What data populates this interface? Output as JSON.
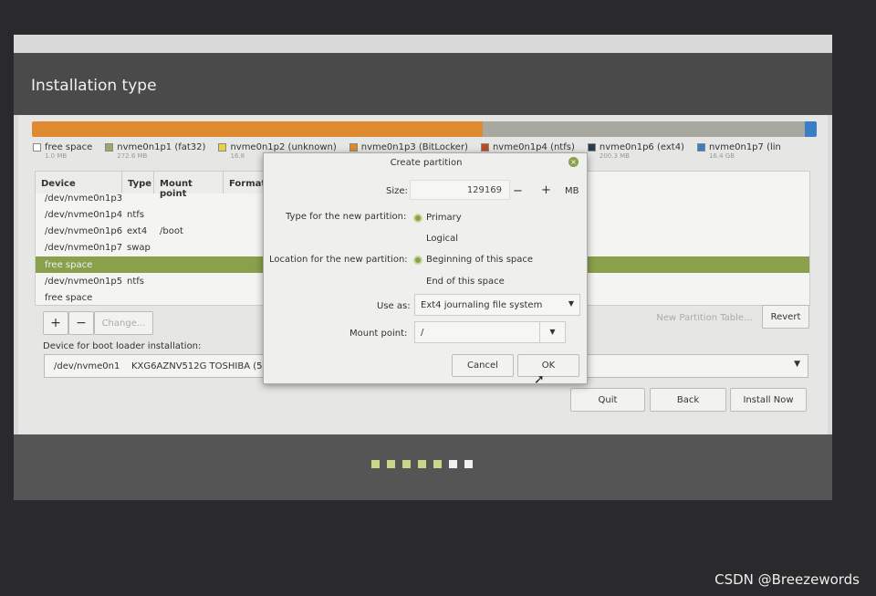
{
  "window": {
    "title": "Installation type"
  },
  "partition_bar": {
    "segments": [
      {
        "color": "#e08a30",
        "share": 0.575
      },
      {
        "color": "#a8a8a0",
        "share": 0.41
      },
      {
        "color": "#3a7ec8",
        "share": 0.015
      }
    ]
  },
  "legend": [
    {
      "name": "free space",
      "size": "1.0 MB",
      "color": "#ffffff"
    },
    {
      "name": "nvme0n1p1 (fat32)",
      "size": "272.6 MB",
      "color": "#9aa868"
    },
    {
      "name": "nvme0n1p2 (unknown)",
      "size": "16.8",
      "color": "#e8d040"
    },
    {
      "name": "nvme0n1p3 (BitLocker)",
      "size": "",
      "color": "#e08a30"
    },
    {
      "name": "nvme0n1p4 (ntfs)",
      "size": "",
      "color": "#c04a20"
    },
    {
      "name": "nvme0n1p6 (ext4)",
      "size": "200.3 MB",
      "color": "#2a3a50"
    },
    {
      "name": "nvme0n1p7 (lin",
      "size": "16.4 GB",
      "color": "#3a7ec8"
    }
  ],
  "table": {
    "headers": [
      "Device",
      "Type",
      "Mount point",
      "Format"
    ],
    "rows": [
      {
        "device": "/dev/nvme0n1p3",
        "type": "",
        "mount": ""
      },
      {
        "device": "/dev/nvme0n1p4",
        "type": "ntfs",
        "mount": ""
      },
      {
        "device": "/dev/nvme0n1p6",
        "type": "ext4",
        "mount": "/boot"
      },
      {
        "device": "/dev/nvme0n1p7",
        "type": "swap",
        "mount": ""
      },
      {
        "device": "free space",
        "type": "",
        "mount": "",
        "selected": true
      },
      {
        "device": "/dev/nvme0n1p5",
        "type": "ntfs",
        "mount": ""
      },
      {
        "device": "free space",
        "type": "",
        "mount": ""
      }
    ]
  },
  "controls": {
    "add": "+",
    "remove": "−",
    "change": "Change...",
    "new_table": "New Partition Table...",
    "revert": "Revert"
  },
  "bootloader": {
    "label": "Device for boot loader installation:",
    "device": "/dev/nvme0n1",
    "model": "KXG6AZNV512G TOSHIBA (51"
  },
  "nav": {
    "quit": "Quit",
    "back": "Back",
    "install": "Install Now"
  },
  "dialog": {
    "title": "Create partition",
    "size_label": "Size:",
    "size_value": "129169",
    "minus": "−",
    "plus": "+",
    "unit": "MB",
    "type_label": "Type for the new partition:",
    "type_options": [
      "Primary",
      "Logical"
    ],
    "type_selected": "Primary",
    "location_label": "Location for the new partition:",
    "location_options": [
      "Beginning of this space",
      "End of this space"
    ],
    "location_selected": "Beginning of this space",
    "use_as_label": "Use as:",
    "use_as_value": "Ext4 journaling file system",
    "mount_label": "Mount point:",
    "mount_value": "/",
    "cancel": "Cancel",
    "ok": "OK"
  },
  "progress": {
    "steps_total": 7,
    "steps_done": 5
  },
  "watermark": "CSDN @Breezewords",
  "colors": {
    "accent": "#8aa04a"
  }
}
